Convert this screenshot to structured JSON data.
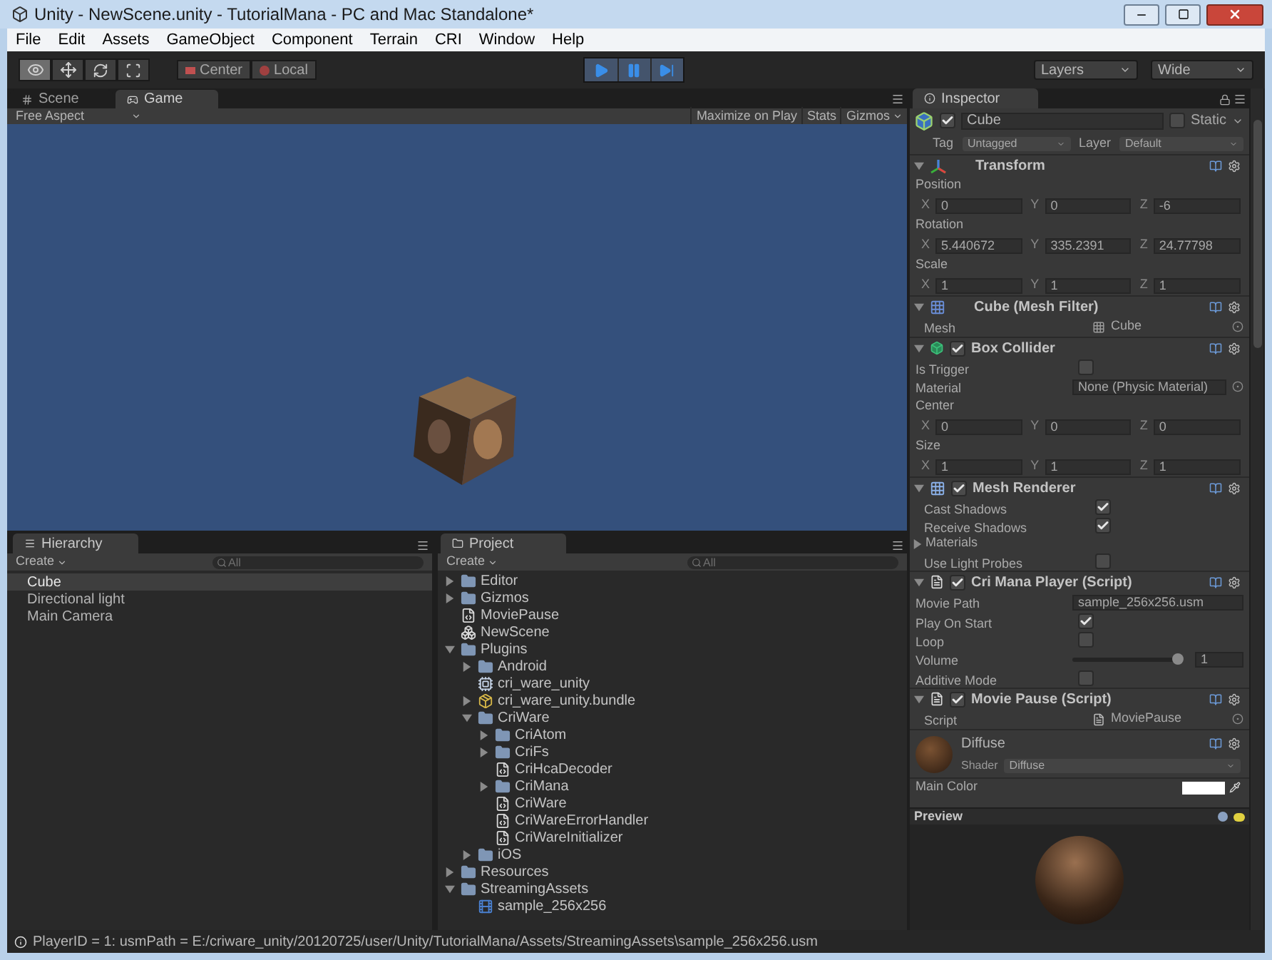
{
  "window": {
    "title": "Unity - NewScene.unity - TutorialMana - PC and Mac Standalone*"
  },
  "menu": [
    "File",
    "Edit",
    "Assets",
    "GameObject",
    "Component",
    "Terrain",
    "CRI",
    "Window",
    "Help"
  ],
  "toolbar": {
    "tools": [
      {
        "kind": "view",
        "selected": true
      },
      {
        "kind": "move",
        "selected": false
      },
      {
        "kind": "rotate",
        "selected": false
      },
      {
        "kind": "scale",
        "selected": false
      }
    ],
    "pivot": [
      {
        "kind": "center",
        "label": "Center"
      },
      {
        "kind": "local",
        "label": "Local"
      }
    ],
    "playback": {
      "playing": true
    },
    "layers": "Layers",
    "layout": "Wide"
  },
  "game": {
    "tabs": [
      {
        "kind": "scene",
        "label": "Scene",
        "selected": false
      },
      {
        "kind": "game",
        "label": "Game",
        "selected": true
      }
    ],
    "aspect": "Free Aspect",
    "buttons": [
      {
        "label": "Maximize on Play",
        "dropdown": false
      },
      {
        "label": "Stats",
        "dropdown": false
      },
      {
        "label": "Gizmos",
        "dropdown": true
      }
    ]
  },
  "hierarchy": {
    "title": "Hierarchy",
    "create": "Create",
    "placeholder": "All",
    "items": [
      {
        "label": "Cube",
        "selected": true
      },
      {
        "label": "Directional light",
        "selected": false
      },
      {
        "label": "Main Camera",
        "selected": false
      }
    ]
  },
  "project": {
    "title": "Project",
    "create": "Create",
    "placeholder": "All",
    "items": [
      {
        "label": "Editor",
        "kind": "folder",
        "expanded": false
      },
      {
        "label": "Gizmos",
        "kind": "folder",
        "expanded": false
      },
      {
        "label": "MoviePause",
        "kind": "script"
      },
      {
        "label": "NewScene",
        "kind": "scene"
      },
      {
        "label": "Plugins",
        "kind": "folder",
        "expanded": true,
        "children": [
          {
            "label": "Android",
            "kind": "folder",
            "expanded": false
          },
          {
            "label": "cri_ware_unity",
            "kind": "plugin"
          },
          {
            "label": "cri_ware_unity.bundle",
            "kind": "bundle",
            "expanded": false
          },
          {
            "label": "CriWare",
            "kind": "folder",
            "expanded": true,
            "children": [
              {
                "label": "CriAtom",
                "kind": "folder",
                "expanded": false
              },
              {
                "label": "CriFs",
                "kind": "folder",
                "expanded": false
              },
              {
                "label": "CriHcaDecoder",
                "kind": "script"
              },
              {
                "label": "CriMana",
                "kind": "folder",
                "expanded": false
              },
              {
                "label": "CriWare",
                "kind": "script"
              },
              {
                "label": "CriWareErrorHandler",
                "kind": "script"
              },
              {
                "label": "CriWareInitializer",
                "kind": "script"
              }
            ]
          },
          {
            "label": "iOS",
            "kind": "folder",
            "expanded": false
          }
        ]
      },
      {
        "label": "Resources",
        "kind": "folder",
        "expanded": false
      },
      {
        "label": "StreamingAssets",
        "kind": "folder",
        "expanded": true,
        "children": [
          {
            "label": "sample_256x256",
            "kind": "movie"
          }
        ]
      }
    ]
  },
  "inspector": {
    "title": "Inspector",
    "object": {
      "name": "Cube",
      "active": true,
      "static_label": "Static",
      "static": false,
      "tag_label": "Tag",
      "tag": "Untagged",
      "layer_label": "Layer",
      "layer": "Default"
    },
    "components": [
      {
        "kind": "transform",
        "title": "Transform",
        "expanded": true,
        "indented": false,
        "rows": [
          {
            "kind": "heading",
            "label": "Position"
          },
          {
            "kind": "xyz",
            "fields": [
              {
                "axis": "X",
                "value": "0"
              },
              {
                "axis": "Y",
                "value": "0"
              },
              {
                "axis": "Z",
                "value": "-6"
              }
            ]
          },
          {
            "kind": "heading",
            "label": "Rotation"
          },
          {
            "kind": "xyz",
            "fields": [
              {
                "axis": "X",
                "value": "5.440672"
              },
              {
                "axis": "Y",
                "value": "335.2391"
              },
              {
                "axis": "Z",
                "value": "24.77798"
              }
            ]
          },
          {
            "kind": "heading",
            "label": "Scale"
          },
          {
            "kind": "xyz",
            "fields": [
              {
                "axis": "X",
                "value": "1"
              },
              {
                "axis": "Y",
                "value": "1"
              },
              {
                "axis": "Z",
                "value": "1"
              }
            ]
          }
        ]
      },
      {
        "kind": "mesh_filter",
        "title": "Cube (Mesh Filter)",
        "expanded": true,
        "indented": true,
        "rows": [
          {
            "kind": "ref",
            "label": "Mesh",
            "value": "Cube"
          }
        ]
      },
      {
        "kind": "collider",
        "title": "Box Collider",
        "enabled": true,
        "expanded": true,
        "indented": false,
        "rows": [
          {
            "kind": "check",
            "label": "Is Trigger",
            "checked": false
          },
          {
            "kind": "field",
            "label": "Material",
            "value": "None (Physic Material)",
            "picker": true
          },
          {
            "kind": "heading",
            "label": "Center"
          },
          {
            "kind": "xyz",
            "fields": [
              {
                "axis": "X",
                "value": "0"
              },
              {
                "axis": "Y",
                "value": "0"
              },
              {
                "axis": "Z",
                "value": "0"
              }
            ]
          },
          {
            "kind": "heading",
            "label": "Size"
          },
          {
            "kind": "xyz",
            "fields": [
              {
                "axis": "X",
                "value": "1"
              },
              {
                "axis": "Y",
                "value": "1"
              },
              {
                "axis": "Z",
                "value": "1"
              }
            ]
          }
        ]
      },
      {
        "kind": "renderer",
        "title": "Mesh Renderer",
        "enabled": true,
        "expanded": true,
        "indented": true,
        "rows": [
          {
            "kind": "check",
            "label": "Cast Shadows",
            "checked": true
          },
          {
            "kind": "check",
            "label": "Receive Shadows",
            "checked": true
          },
          {
            "kind": "foldout",
            "label": "Materials",
            "expanded": false
          },
          {
            "kind": "check",
            "label": "Use Light Probes",
            "checked": false
          }
        ]
      },
      {
        "kind": "script",
        "title": "Cri Mana Player (Script)",
        "enabled": true,
        "expanded": true,
        "indented": false,
        "rows": [
          {
            "kind": "field",
            "label": "Movie Path",
            "value": "sample_256x256.usm",
            "picker": false
          },
          {
            "kind": "check",
            "label": "Play On Start",
            "checked": true
          },
          {
            "kind": "check",
            "label": "Loop",
            "checked": false
          },
          {
            "kind": "slider",
            "label": "Volume",
            "level": 1,
            "value": "1"
          },
          {
            "kind": "check",
            "label": "Additive Mode",
            "checked": false
          }
        ]
      },
      {
        "kind": "script",
        "title": "Movie Pause (Script)",
        "enabled": true,
        "expanded": true,
        "indented": true,
        "rows": [
          {
            "kind": "ref",
            "label": "Script",
            "value": "MoviePause"
          }
        ]
      }
    ],
    "material": {
      "name": "Diffuse",
      "shader_label": "Shader",
      "shader": "Diffuse",
      "main_color_label": "Main Color"
    }
  },
  "preview": {
    "title": "Preview"
  },
  "status": {
    "message": "PlayerID = 1: usmPath = E:/criware_unity/20120725/user/Unity/TutorialMana/Assets/StreamingAssets\\sample_256x256.usm"
  }
}
